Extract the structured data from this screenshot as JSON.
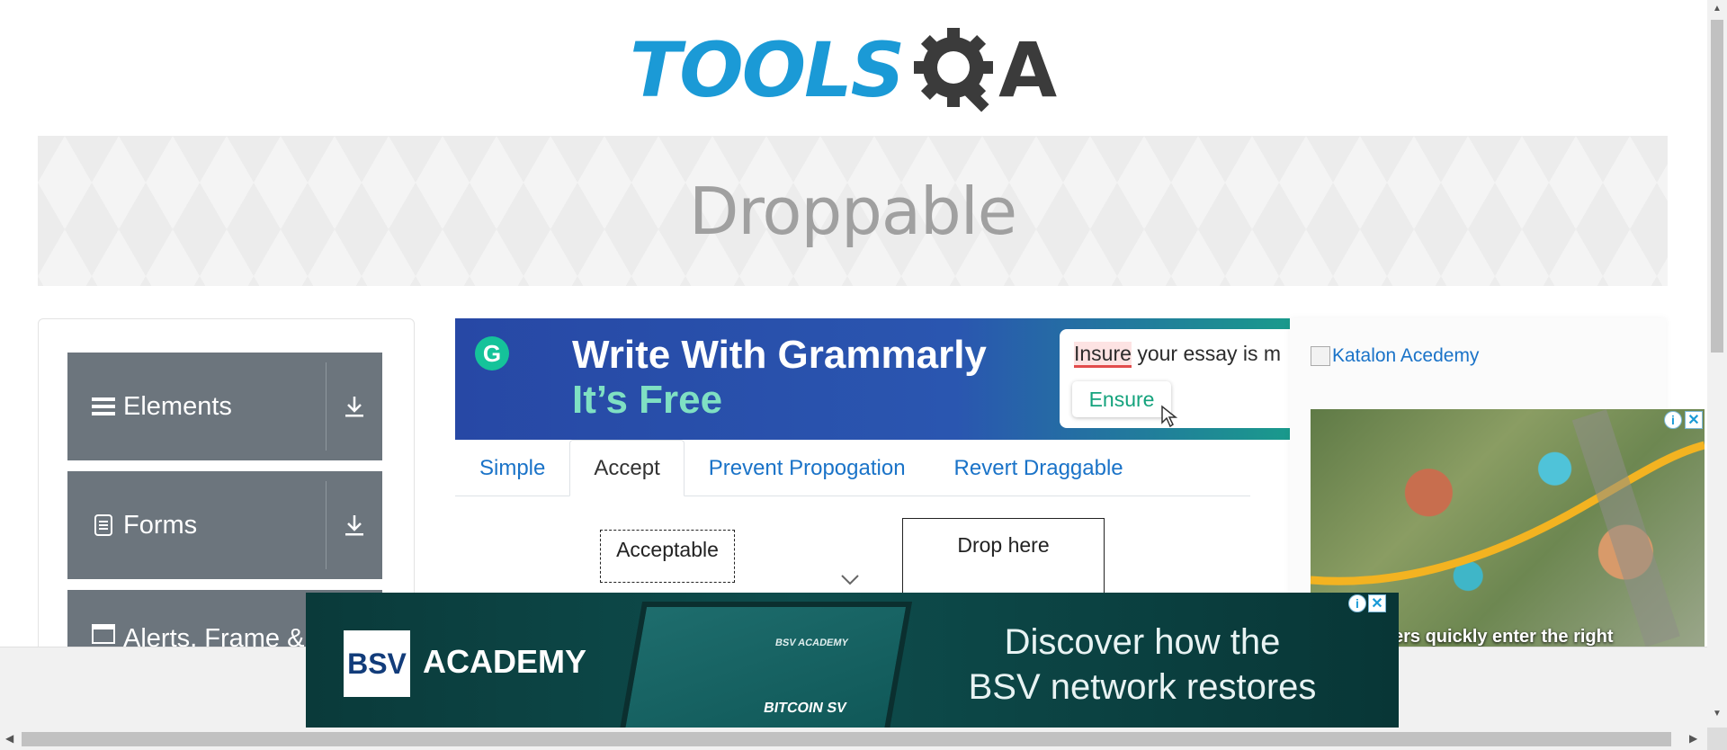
{
  "logo": {
    "tools_text": "TOOLS",
    "qa_text": "A"
  },
  "banner": {
    "title": "Droppable"
  },
  "sidebar": {
    "groups": [
      {
        "label": "Elements",
        "icon": "hamburger-icon"
      },
      {
        "label": "Forms",
        "icon": "document-icon"
      },
      {
        "label": "Alerts, Frame &",
        "icon": "window-icon"
      }
    ]
  },
  "grammarly_ad": {
    "logo_letter": "G",
    "line1": "Write With Grammarly",
    "line2": "It’s Free",
    "sentence_error_word": "Insure",
    "sentence_rest": " your essay is m",
    "suggestion": "Ensure"
  },
  "tabs": [
    {
      "label": "Simple",
      "active": false
    },
    {
      "label": "Accept",
      "active": true
    },
    {
      "label": "Prevent Propogation",
      "active": false
    },
    {
      "label": "Revert Draggable",
      "active": false
    }
  ],
  "content": {
    "draggable_label": "Acceptable",
    "drop_label": "Drop here"
  },
  "right_ads": {
    "katalon_link": "Katalon Acedemy",
    "house_caption": "ers quickly enter the right",
    "info_glyph": "i",
    "close_glyph": "✕"
  },
  "bsv_ad": {
    "logo": "BSV",
    "brand": "ACADEMY",
    "tablet_brand": "BSV ACADEMY",
    "tablet_title": "BITCOIN SV",
    "headline_line1": "Discover how the",
    "headline_line2": "BSV network restores",
    "info_glyph": "i",
    "close_glyph": "✕"
  },
  "colors": {
    "accent": "#1b9ad6",
    "sidebar_group": "#6c757d",
    "link": "#1a73c8"
  }
}
